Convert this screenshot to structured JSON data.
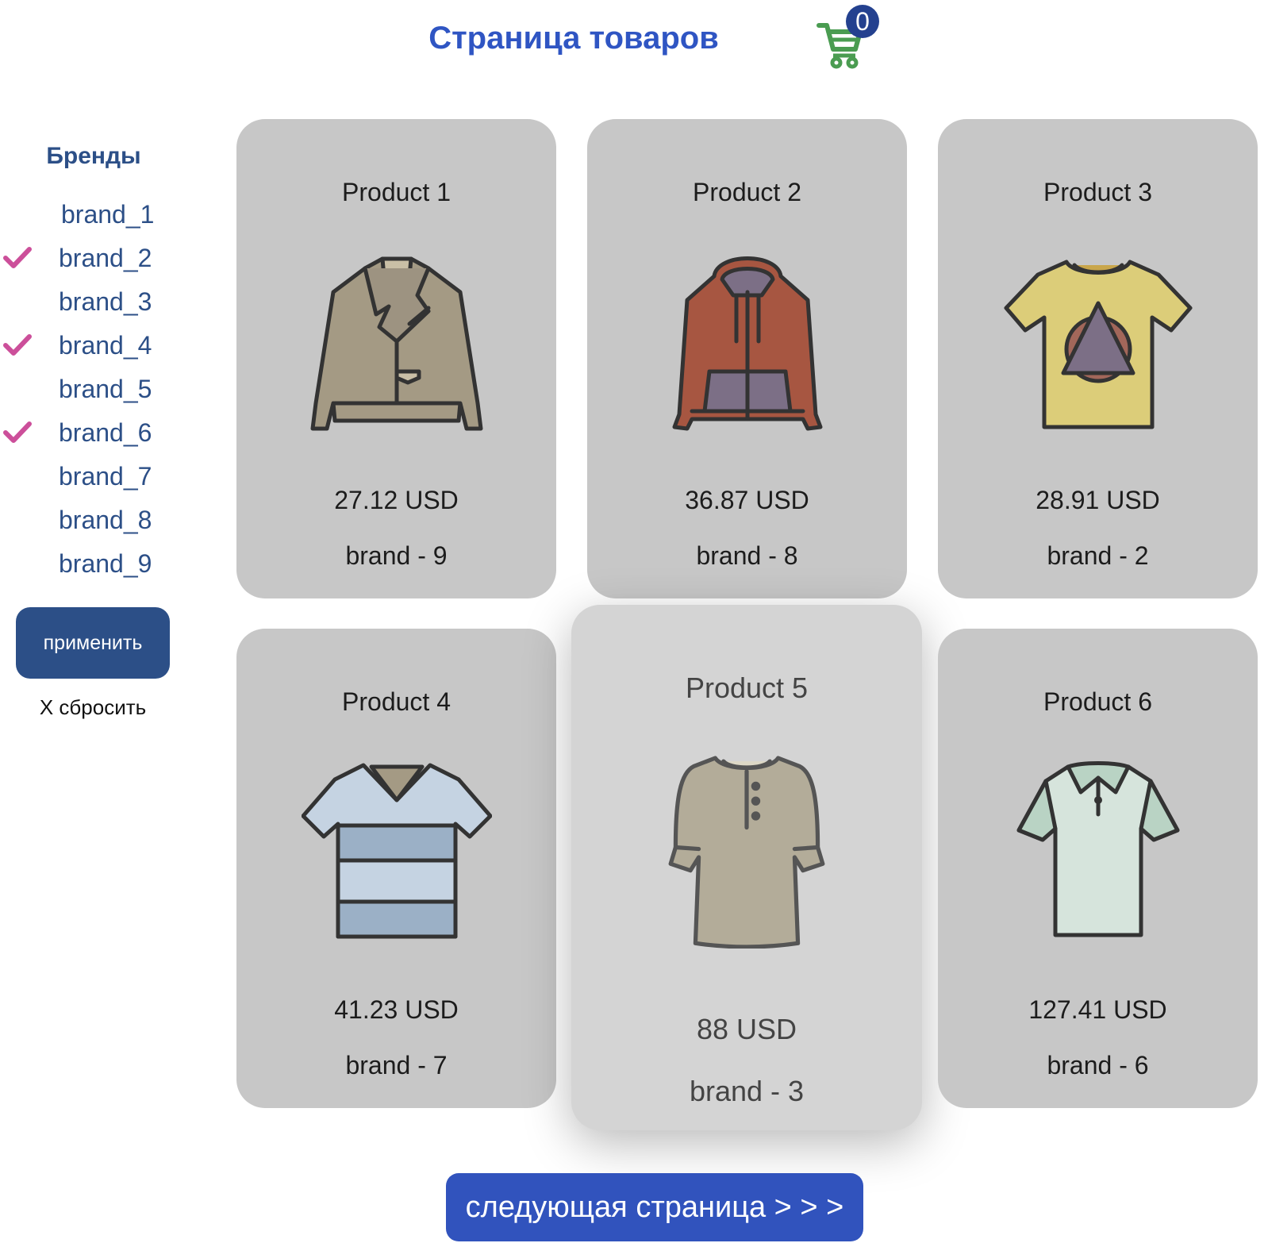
{
  "header": {
    "title": "Страница товаров",
    "cart_count": "0",
    "cart_icon": "cart-icon"
  },
  "sidebar": {
    "title": "Бренды",
    "brands": [
      {
        "label": "brand_1",
        "checked": false
      },
      {
        "label": "brand_2",
        "checked": true
      },
      {
        "label": "brand_3",
        "checked": false
      },
      {
        "label": "brand_4",
        "checked": true
      },
      {
        "label": "brand_5",
        "checked": false
      },
      {
        "label": "brand_6",
        "checked": true
      },
      {
        "label": "brand_7",
        "checked": false
      },
      {
        "label": "brand_8",
        "checked": false
      },
      {
        "label": "brand_9",
        "checked": false
      }
    ],
    "apply_label": "применить",
    "reset_label": "Х сбросить"
  },
  "products": [
    {
      "name": "Product 1",
      "price": "27.12 USD",
      "brand": "brand - 9",
      "icon": "leather-jacket-icon"
    },
    {
      "name": "Product 2",
      "price": "36.87 USD",
      "brand": "brand - 8",
      "icon": "hoodie-icon"
    },
    {
      "name": "Product 3",
      "price": "28.91 USD",
      "brand": "brand - 2",
      "icon": "graphic-tshirt-icon"
    },
    {
      "name": "Product 4",
      "price": "41.23 USD",
      "brand": "brand - 7",
      "icon": "striped-tshirt-icon"
    },
    {
      "name": "Product 5",
      "price": "88 USD",
      "brand": "brand - 3",
      "icon": "henley-shirt-icon"
    },
    {
      "name": "Product 6",
      "price": "127.41 USD",
      "brand": "brand - 6",
      "icon": "polo-shirt-icon"
    }
  ],
  "pagination": {
    "next_label": "следующая страница > > >"
  },
  "colors": {
    "accent": "#2f55c3",
    "sidebar_text": "#2c4f87",
    "check": "#cc4f9a",
    "cart": "#4a9c51",
    "card_bg": "#c7c7c7"
  }
}
